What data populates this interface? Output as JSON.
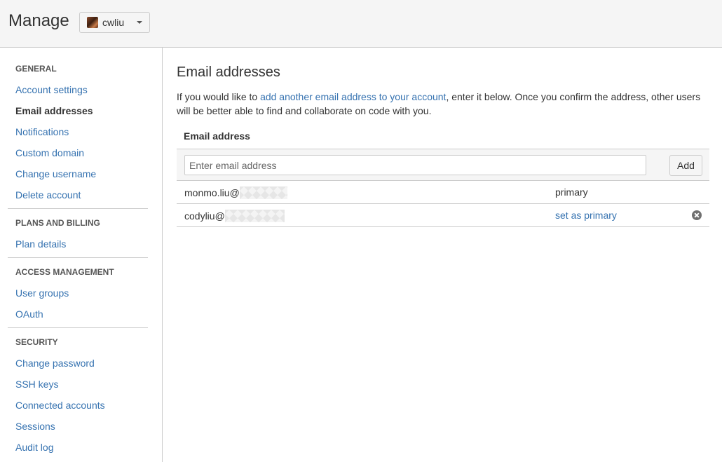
{
  "header": {
    "title": "Manage",
    "account": {
      "name": "cwliu",
      "avatar_icon": "user-avatar"
    }
  },
  "sidebar": {
    "sections": [
      {
        "heading": "GENERAL",
        "items": [
          {
            "label": "Account settings",
            "active": false
          },
          {
            "label": "Email addresses",
            "active": true
          },
          {
            "label": "Notifications",
            "active": false
          },
          {
            "label": "Custom domain",
            "active": false
          },
          {
            "label": "Change username",
            "active": false
          },
          {
            "label": "Delete account",
            "active": false
          }
        ]
      },
      {
        "heading": "PLANS AND BILLING",
        "items": [
          {
            "label": "Plan details",
            "active": false
          }
        ]
      },
      {
        "heading": "ACCESS MANAGEMENT",
        "items": [
          {
            "label": "User groups",
            "active": false
          },
          {
            "label": "OAuth",
            "active": false
          }
        ]
      },
      {
        "heading": "SECURITY",
        "items": [
          {
            "label": "Change password",
            "active": false
          },
          {
            "label": "SSH keys",
            "active": false
          },
          {
            "label": "Connected accounts",
            "active": false
          },
          {
            "label": "Sessions",
            "active": false
          },
          {
            "label": "Audit log",
            "active": false
          }
        ]
      }
    ]
  },
  "main": {
    "title": "Email addresses",
    "intro_before": "If you would like to ",
    "intro_link": "add another email address to your account",
    "intro_after": ", enter it below. Once you confirm the address, other users will be better able to find and collaborate on code with you.",
    "column_header": "Email address",
    "input": {
      "placeholder": "Enter email address",
      "value": ""
    },
    "add_label": "Add",
    "emails": [
      {
        "address": "monmo.liu@",
        "status": "primary",
        "status_is_link": false,
        "removable": false
      },
      {
        "address": "codyliu@",
        "status": "set as primary",
        "status_is_link": true,
        "removable": true
      }
    ]
  },
  "colors": {
    "link": "#3572b0",
    "text": "#333333",
    "header_bg": "#f5f5f5",
    "border": "#cccccc"
  }
}
